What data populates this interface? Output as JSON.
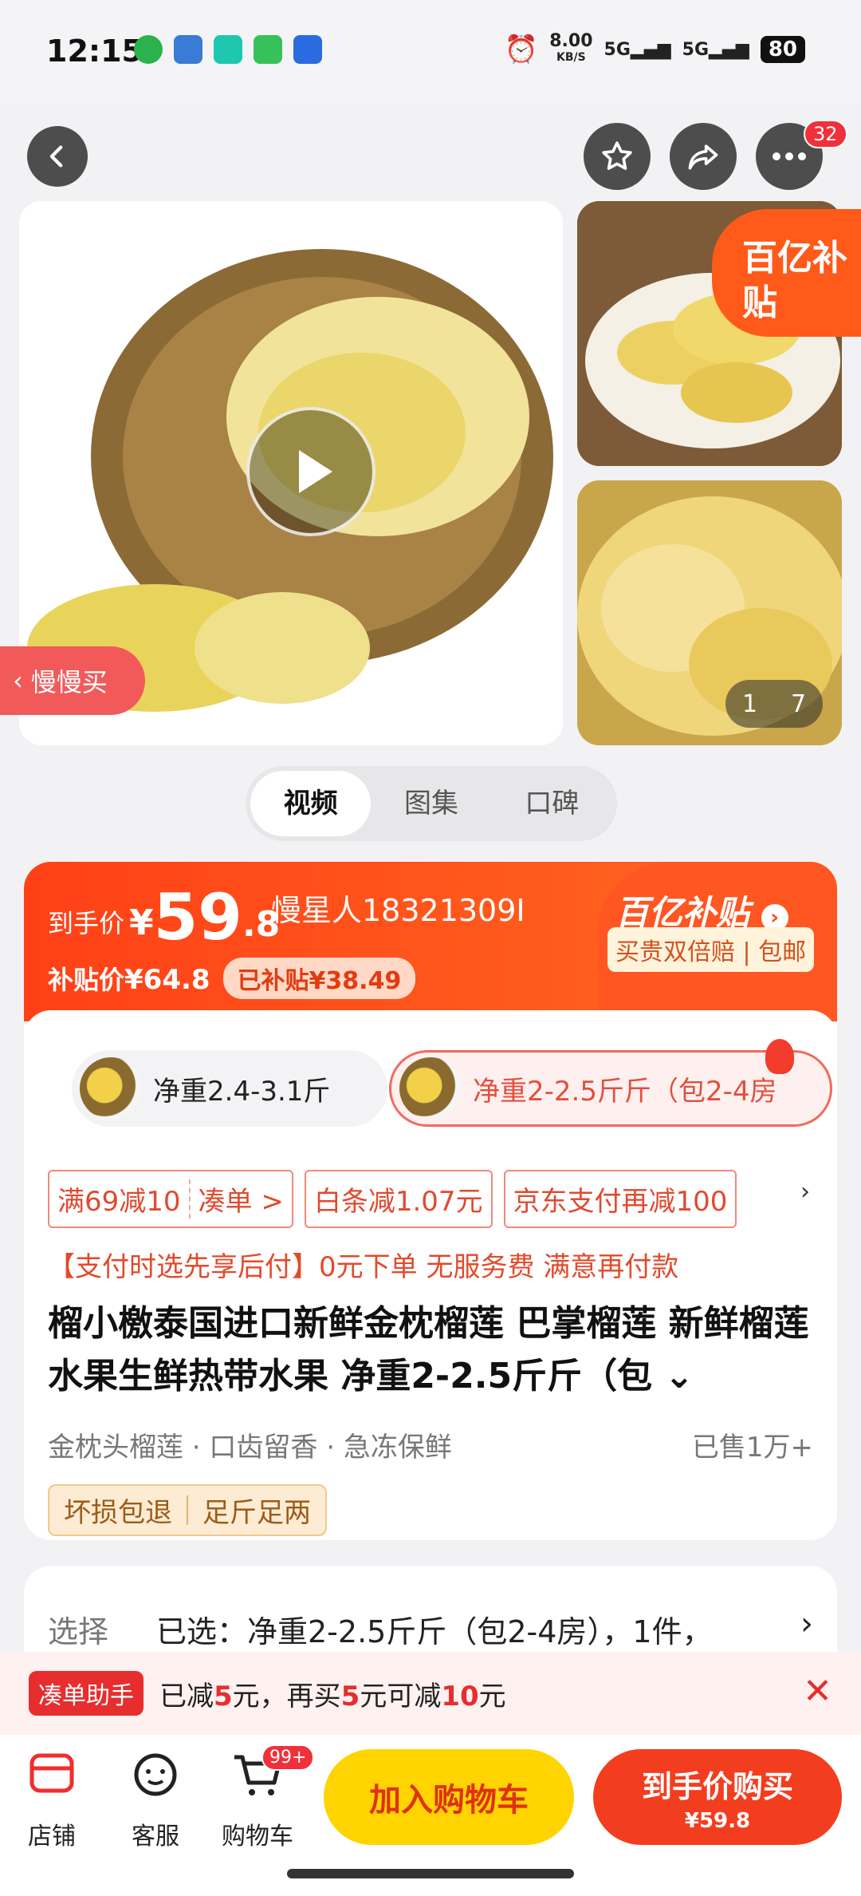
{
  "status_bar": {
    "time": "12:15",
    "speed": "8.00",
    "speed_unit": "KB/S",
    "signal1": "5G",
    "signal2": "5G",
    "battery": "80"
  },
  "header": {
    "notification_badge": "32"
  },
  "gallery": {
    "subsidy_tag": "百亿补贴",
    "slow_buy": "慢慢买",
    "counter_current": "1",
    "counter_total": "7"
  },
  "tabs": [
    {
      "label": "视频"
    },
    {
      "label": "图集"
    },
    {
      "label": "口碑"
    }
  ],
  "price": {
    "label": "到手价",
    "currency": "¥",
    "integer": "59",
    "decimal": ".8",
    "user": "慢星人18321309I",
    "subsidy_label": "补贴价",
    "subsidy_price": "¥64.8",
    "subsidized": "已补贴¥38.49",
    "brand": "百亿补贴",
    "promise": "买贵双倍赔 | 包邮"
  },
  "specs": [
    {
      "label": "净重2.4-3.1斤"
    },
    {
      "label": "净重2-2.5斤斤（包2-4房"
    }
  ],
  "coupons": {
    "c1_left": "满69减10",
    "c1_right": "凑单 >",
    "c2": "白条减1.07元",
    "c3": "京东支付再减100"
  },
  "pay_note": "【支付时选先享后付】0元下单 无服务费 满意再付款",
  "product": {
    "title": "榴小檄泰国进口新鲜金枕榴莲 巴掌榴莲 新鲜榴莲水果生鲜热带水果 净重2-2.5斤斤（包",
    "features": "金枕头榴莲 · 口齿留香 · 急冻保鲜",
    "sold": "已售1万+",
    "tag1": "坏损包退",
    "tag2": "足斤足两"
  },
  "select": {
    "label": "选择",
    "value": "已选：净重2-2.5斤斤（包2-4房），1件，"
  },
  "helper": {
    "tag": "凑单助手",
    "text_a": "已减",
    "num1": "5",
    "text_b": "元，再买",
    "num2": "5",
    "text_c": "元可减",
    "num3": "10",
    "text_d": "元"
  },
  "bottom_nav": {
    "store": "店铺",
    "service": "客服",
    "cart": "购物车",
    "cart_badge": "99+",
    "add_cart": "加入购物车",
    "buy_line1": "到手价购买",
    "buy_line2": "¥59.8"
  },
  "colors": {
    "accent": "#f33d1f",
    "yellow": "#ffd400",
    "brand_orange": "#ff5a1a"
  }
}
